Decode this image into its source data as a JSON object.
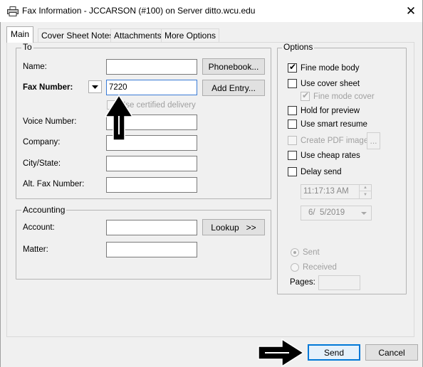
{
  "window": {
    "title": "Fax Information - JCCARSON (#100) on Server ditto.wcu.edu",
    "close_glyph": "✕"
  },
  "tabs": [
    {
      "label": "Main",
      "active": true
    },
    {
      "label": "Cover Sheet Notes",
      "active": false
    },
    {
      "label": "Attachments",
      "active": false
    },
    {
      "label": "More Options",
      "active": false
    }
  ],
  "to_group": {
    "legend": "To",
    "name_label": "Name:",
    "name_value": "",
    "fax_number_label": "Fax Number:",
    "fax_number_value": "7220",
    "phonebook_button": "Phonebook...",
    "add_entry_button": "Add Entry...",
    "certified_label": "Use certified delivery",
    "certified_checked": false,
    "voice_label": "Voice Number:",
    "voice_value": "",
    "company_label": "Company:",
    "company_value": "",
    "city_label": "City/State:",
    "city_value": "",
    "alt_fax_label": "Alt. Fax Number:",
    "alt_fax_value": ""
  },
  "accounting_group": {
    "legend": "Accounting",
    "account_label": "Account:",
    "account_value": "",
    "lookup_button": "Lookup   >>",
    "matter_label": "Matter:",
    "matter_value": ""
  },
  "options_group": {
    "legend": "Options",
    "fine_mode_body": {
      "label": "Fine mode body",
      "checked": true,
      "enabled": true
    },
    "use_cover_sheet": {
      "label": "Use cover sheet",
      "checked": false,
      "enabled": true
    },
    "fine_mode_cover": {
      "label": "Fine mode cover",
      "checked": true,
      "enabled": false
    },
    "hold_for_preview": {
      "label": "Hold for preview",
      "checked": false,
      "enabled": true
    },
    "use_smart_resume": {
      "label": "Use smart resume",
      "checked": false,
      "enabled": true
    },
    "create_pdf_image": {
      "label": "Create PDF image",
      "checked": false,
      "enabled": false
    },
    "pdf_browse_button": "...",
    "use_cheap_rates": {
      "label": "Use cheap rates",
      "checked": false,
      "enabled": true
    },
    "delay_send": {
      "label": "Delay send",
      "checked": false,
      "enabled": true
    },
    "delay_time": "11:17:13 AM",
    "delay_date": "6/  5/2019",
    "sent_label": "Sent",
    "sent_selected": true,
    "received_label": "Received",
    "received_selected": false,
    "pages_label": "Pages:",
    "pages_value": ""
  },
  "footer": {
    "send_button": "Send",
    "cancel_button": "Cancel"
  },
  "icons": [
    "printer-icon",
    "close-icon",
    "dropdown-arrow-icon",
    "check-icon",
    "spin-up-icon",
    "spin-down-icon"
  ],
  "colors": {
    "accent": "#0078d7",
    "annotation_arrow": "#000000"
  }
}
